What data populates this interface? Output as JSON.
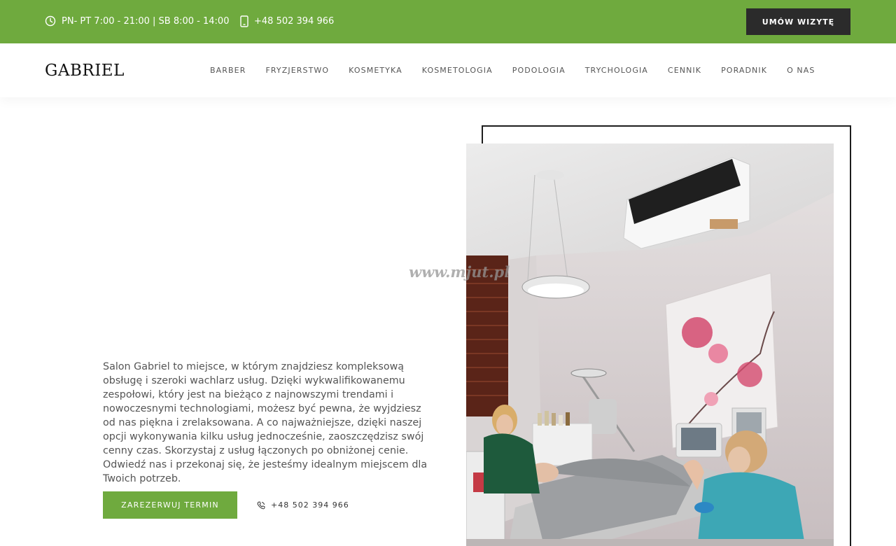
{
  "topbar": {
    "hours": "PN- PT 7:00 - 21:00 | SB 8:00 - 14:00",
    "phone": "+48 502 394 966",
    "cta": "UMÓW WIZYTĘ",
    "bg_color": "#6faa3e"
  },
  "brand": {
    "logo": "GABRIEL"
  },
  "nav": {
    "items": [
      "BARBER",
      "FRYZJERSTWO",
      "KOSMETYKA",
      "KOSMETOLOGIA",
      "PODOLOGIA",
      "TRYCHOLOGIA",
      "CENNIK",
      "PORADNIK",
      "O NAS"
    ]
  },
  "hero": {
    "watermark": "www.mjut.pl",
    "description": "Salon Gabriel to miejsce, w którym znajdziesz kompleksową obsługę i szeroki wachlarz usług. Dzięki wykwalifikowanemu zespołowi, który jest na bieżąco z najnowszymi trendami i nowoczesnymi technologiami, możesz być pewna, że wyjdziesz od nas piękna i zrelaksowana. A co najważniejsze, dzięki naszej opcji wykonywania kilku usług jednocześnie, zaoszczędzisz swój cenny czas. Skorzystaj z usług łączonych po obniżonej cenie. Odwiedź nas i przekonaj się, że jesteśmy idealnym miejscem dla Twoich potrzeb.",
    "book_button": "ZAREZERWUJ TERMIN",
    "phone": "+48 502 394 966",
    "photo_icon": "beauty-salon-treatment-photo"
  }
}
